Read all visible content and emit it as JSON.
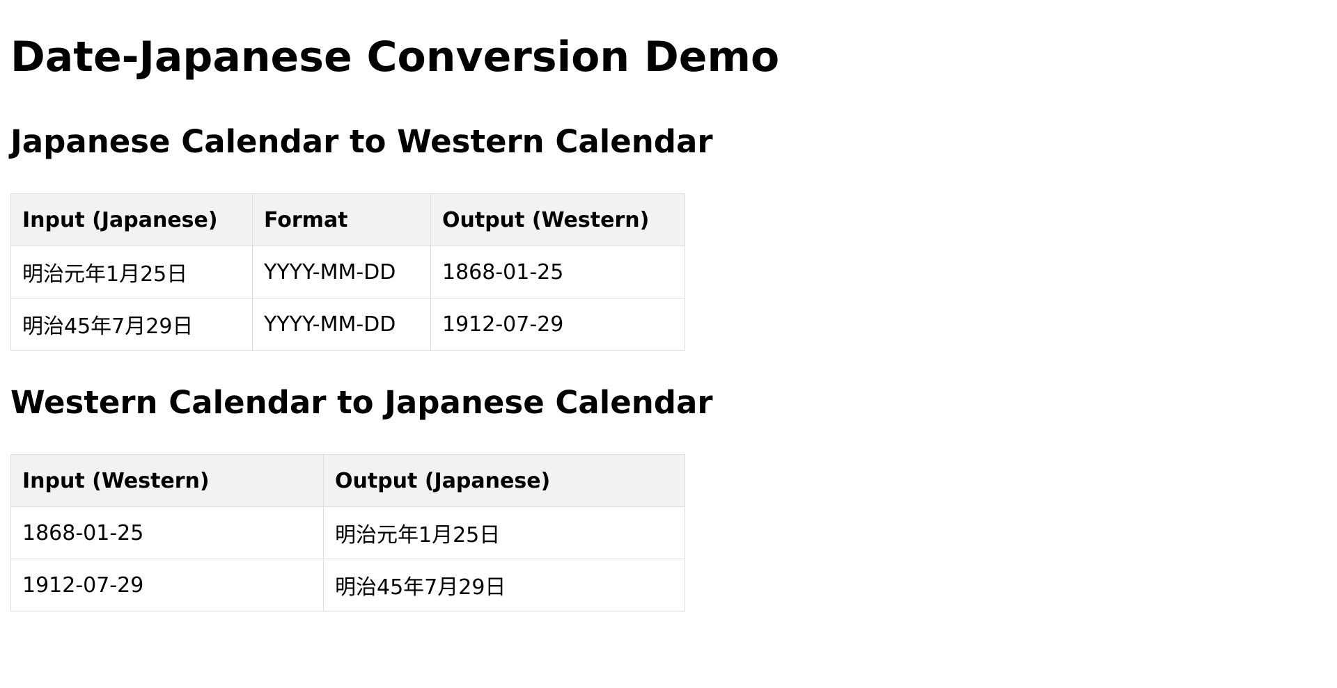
{
  "page": {
    "title": "Date-Japanese Conversion Demo"
  },
  "section1": {
    "title": "Japanese Calendar to Western Calendar",
    "headers": [
      "Input (Japanese)",
      "Format",
      "Output (Western)"
    ],
    "rows": [
      [
        "明治元年1月25日",
        "YYYY-MM-DD",
        "1868-01-25"
      ],
      [
        "明治45年7月29日",
        "YYYY-MM-DD",
        "1912-07-29"
      ]
    ]
  },
  "section2": {
    "title": "Western Calendar to Japanese Calendar",
    "headers": [
      "Input (Western)",
      "Output (Japanese)"
    ],
    "rows": [
      [
        "1868-01-25",
        "明治元年1月25日"
      ],
      [
        "1912-07-29",
        "明治45年7月29日"
      ]
    ]
  },
  "colors": {
    "header_bg": "#f2f2f2",
    "border": "#dddddd",
    "text": "#000000",
    "background": "#ffffff"
  }
}
